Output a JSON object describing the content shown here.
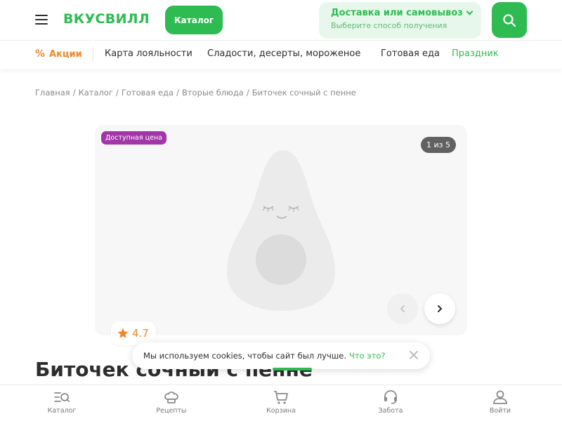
{
  "header": {
    "logo": "ВКУСВИЛЛ",
    "catalog_button": "Каталог",
    "delivery_title": "Доставка или самовывоз",
    "delivery_subtitle": "Выберите способ получения"
  },
  "nav": {
    "promo": "Акции",
    "items": [
      "Карта лояльности",
      "Сладости, десерты, мороженое",
      "Готовая еда",
      "Праздник"
    ]
  },
  "breadcrumb": [
    "Главная",
    "Каталог",
    "Готовая еда",
    "Вторые блюда",
    "Биточек сочный с пенне"
  ],
  "gallery": {
    "badge": "Доступная цена",
    "counter": "1 из 5"
  },
  "rating": "4.7",
  "product": {
    "title": "Биточек сочный с пенне"
  },
  "cookie": {
    "text": "Мы используем cookies, чтобы сайт был лучше.",
    "link": "Что это?"
  },
  "bottom_nav": [
    "Каталог",
    "Рецепты",
    "Корзина",
    "Забота",
    "Войти"
  ],
  "colors": {
    "brand_green": "#2dbb52",
    "promo_orange": "#f0862c",
    "badge_purple": "#a235a8"
  },
  "icons": [
    "menu-icon",
    "search-icon",
    "chevron-down-icon",
    "percent-icon",
    "avocado-placeholder",
    "chevron-left-icon",
    "chevron-right-icon",
    "star-icon",
    "close-icon",
    "catalog-icon",
    "chef-hat-icon",
    "cart-icon",
    "headset-icon",
    "user-icon"
  ]
}
